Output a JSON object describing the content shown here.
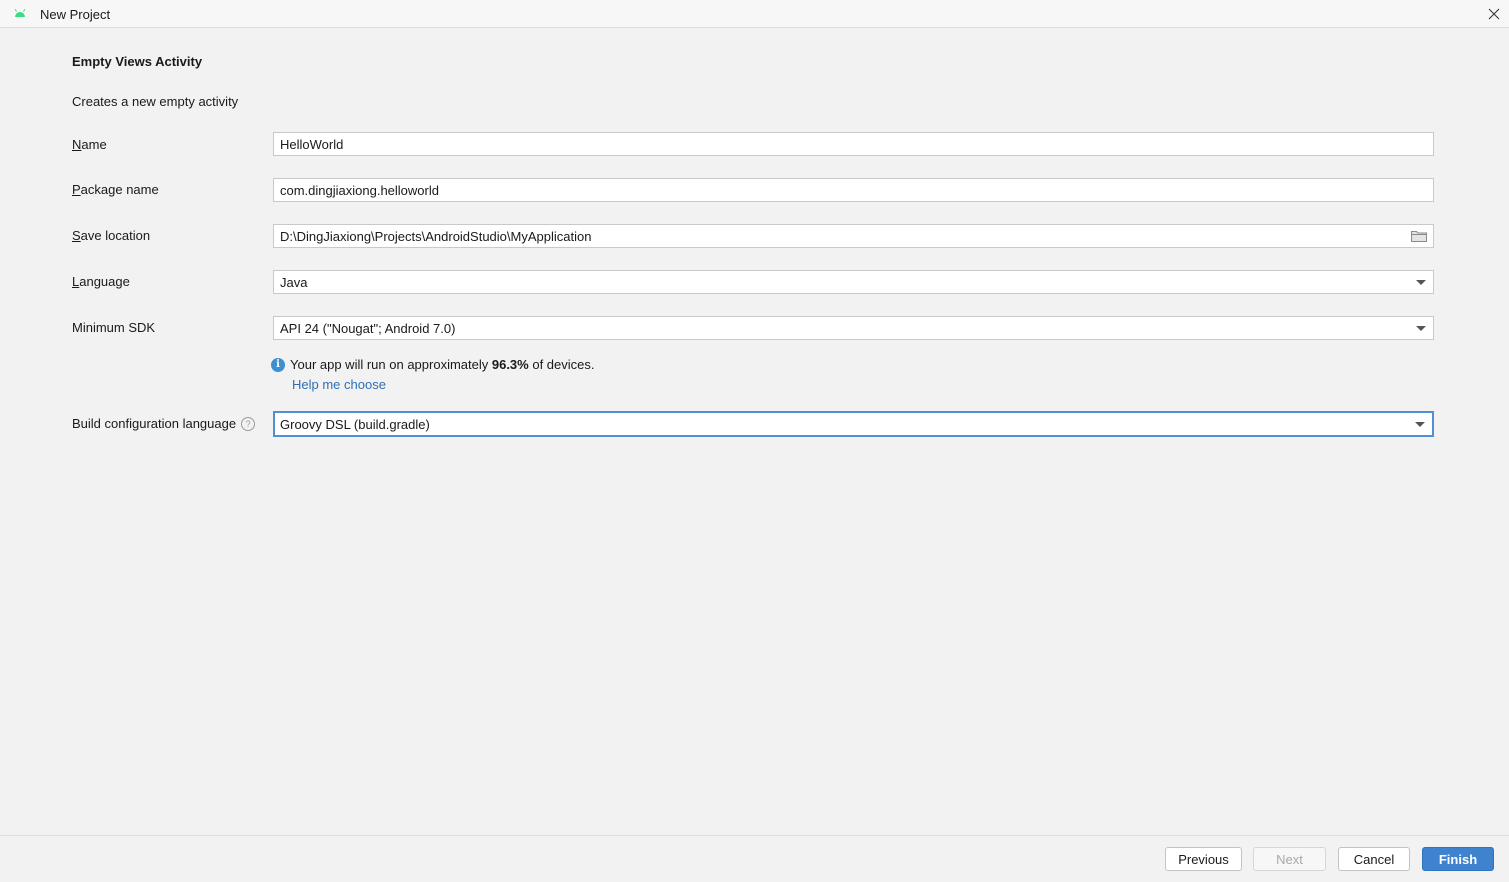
{
  "window": {
    "title": "New Project",
    "app_icon": "android-icon",
    "close_icon": "close-icon"
  },
  "template": {
    "heading": "Empty Views Activity",
    "description": "Creates a new empty activity"
  },
  "form": {
    "name": {
      "label_mnemonic": "N",
      "label_rest": "ame",
      "value": "HelloWorld"
    },
    "package_name": {
      "label_mnemonic": "P",
      "label_rest": "ackage name",
      "value": "com.dingjiaxiong.helloworld"
    },
    "save_location": {
      "label_mnemonic": "S",
      "label_rest": "ave location",
      "value": "D:\\DingJiaxiong\\Projects\\AndroidStudio\\MyApplication",
      "icon": "folder-icon"
    },
    "language": {
      "label_mnemonic": "L",
      "label_rest": "anguage",
      "value": "Java"
    },
    "minimum_sdk": {
      "label": "Minimum SDK",
      "value": "API 24 (\"Nougat\"; Android 7.0)"
    },
    "sdk_info": {
      "prefix": "Your app will run on approximately ",
      "percentage": "96.3%",
      "suffix": " of devices.",
      "help_link": "Help me choose"
    },
    "build_config_language": {
      "label": "Build configuration language",
      "help_mark": "?",
      "value": "Groovy DSL (build.gradle)"
    }
  },
  "footer": {
    "previous": "Previous",
    "next": "Next",
    "cancel": "Cancel",
    "finish": "Finish"
  },
  "colors": {
    "accent": "#3f83cf",
    "focus_border": "#4f8fd8",
    "link": "#2f6fb5",
    "android_green": "#3ddc84"
  }
}
